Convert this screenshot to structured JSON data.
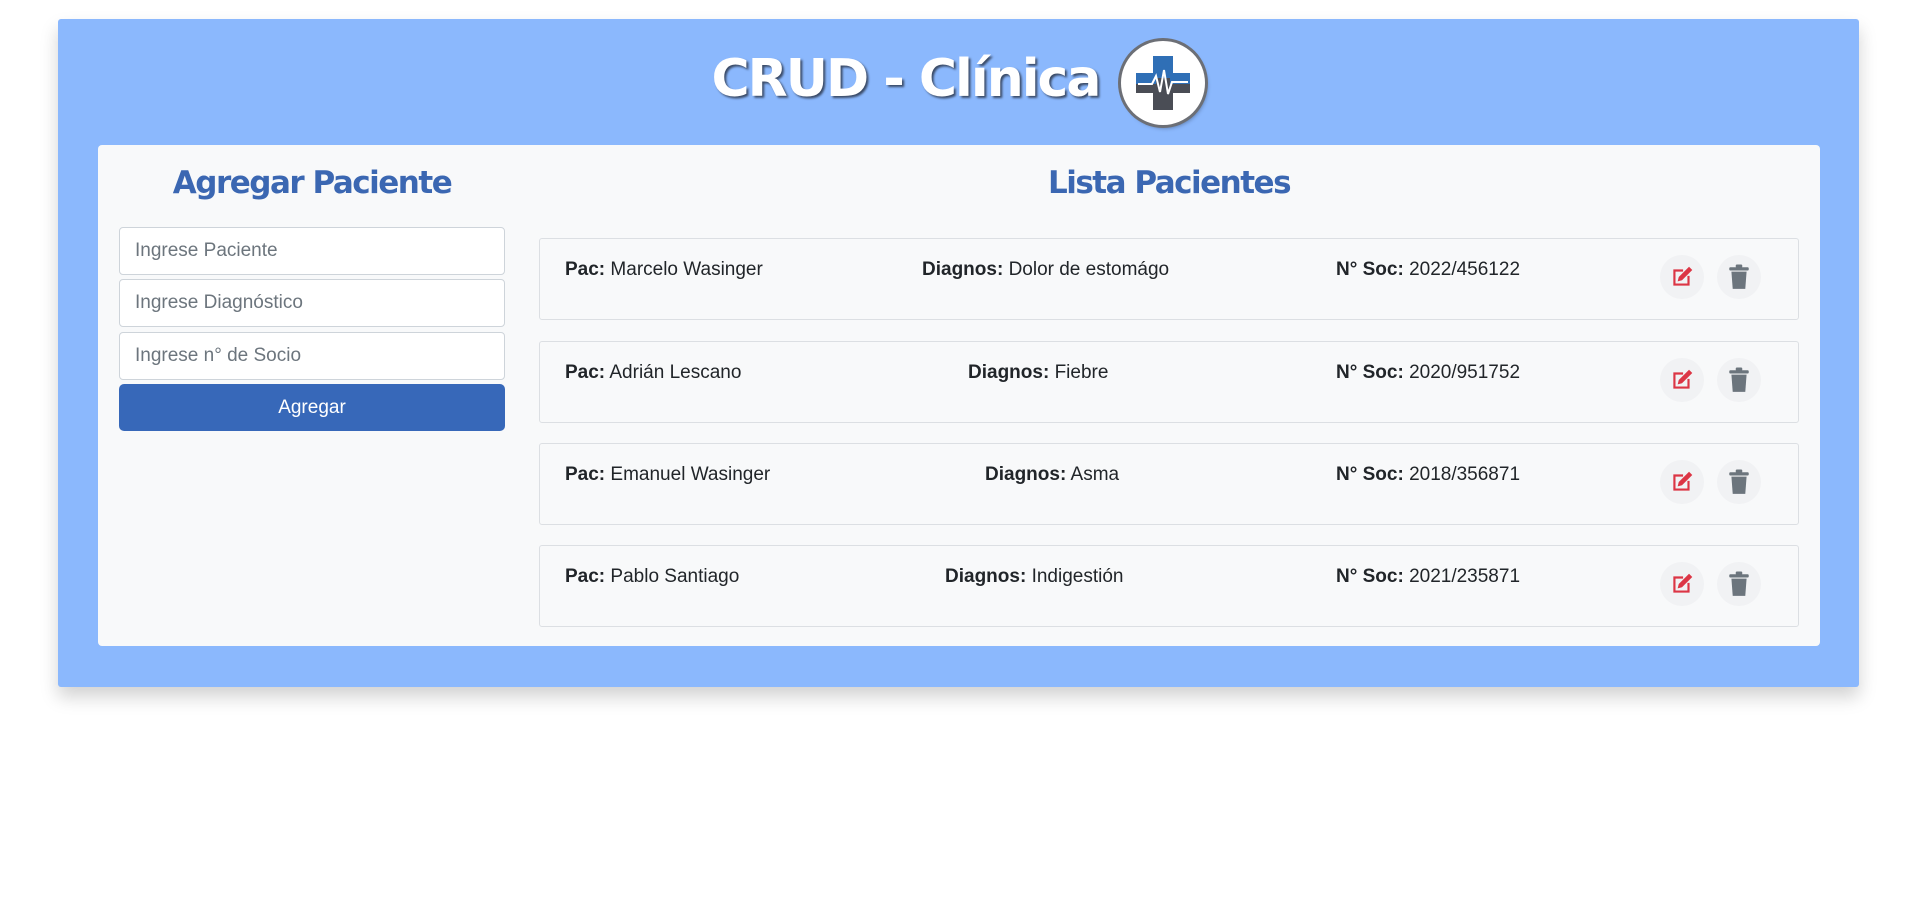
{
  "header": {
    "title": "CRUD - Clínica",
    "logo_icon": "medical-cross-heartbeat-icon"
  },
  "form": {
    "title": "Agregar Paciente",
    "patient_placeholder": "Ingrese Paciente",
    "diagnosis_placeholder": "Ingrese Diagnóstico",
    "member_placeholder": "Ingrese n° de Socio",
    "submit_label": "Agregar"
  },
  "list": {
    "title": "Lista Pacientes",
    "label_patient": "Pac:",
    "label_diagnosis": "Diagnos:",
    "label_member": "N° Soc:",
    "edit_icon": "edit-icon",
    "delete_icon": "trash-icon",
    "items": [
      {
        "patient": "Marcelo Wasinger",
        "diagnosis": "Dolor de estomágo",
        "member": "2022/456122"
      },
      {
        "patient": "Adrián Lescano",
        "diagnosis": "Fiebre",
        "member": "2020/951752"
      },
      {
        "patient": "Emanuel Wasinger",
        "diagnosis": "Asma",
        "member": "2018/356871"
      },
      {
        "patient": "Pablo Santiago",
        "diagnosis": "Indigestión",
        "member": "2021/235871"
      }
    ]
  },
  "colors": {
    "page_bg": "#8bb8fd",
    "panel_bg": "#f8f9fa",
    "title_blue": "#3b67b2",
    "button_blue": "#3768b9",
    "edit_red": "#dc3545",
    "delete_gray": "#6c757d"
  }
}
